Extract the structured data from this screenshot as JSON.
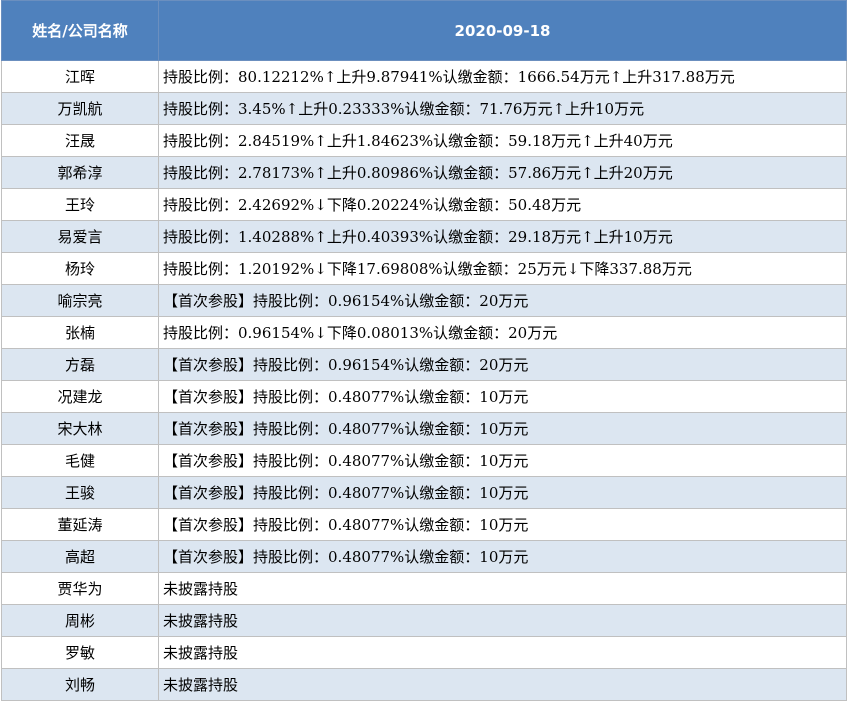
{
  "table": {
    "headers": [
      "姓名/公司名称",
      "2020-09-18"
    ],
    "rows": [
      {
        "name": "江晖",
        "info": "持股比例：80.12212%↑上升9.87941%认缴金额：1666.54万元↑上升317.88万元"
      },
      {
        "name": "万凯航",
        "info": "持股比例：3.45%↑上升0.23333%认缴金额：71.76万元↑上升10万元"
      },
      {
        "name": "汪晟",
        "info": "持股比例：2.84519%↑上升1.84623%认缴金额：59.18万元↑上升40万元"
      },
      {
        "name": "郭希淳",
        "info": "持股比例：2.78173%↑上升0.80986%认缴金额：57.86万元↑上升20万元"
      },
      {
        "name": "王玲",
        "info": "持股比例：2.42692%↓下降0.20224%认缴金额：50.48万元"
      },
      {
        "name": "易爱言",
        "info": "持股比例：1.40288%↑上升0.40393%认缴金额：29.18万元↑上升10万元"
      },
      {
        "name": "杨玲",
        "info": "持股比例：1.20192%↓下降17.69808%认缴金额：25万元↓下降337.88万元"
      },
      {
        "name": "喻宗亮",
        "info": "【首次参股】持股比例：0.96154%认缴金额：20万元"
      },
      {
        "name": "张楠",
        "info": "持股比例：0.96154%↓下降0.08013%认缴金额：20万元"
      },
      {
        "name": "方磊",
        "info": "【首次参股】持股比例：0.96154%认缴金额：20万元"
      },
      {
        "name": "况建龙",
        "info": "【首次参股】持股比例：0.48077%认缴金额：10万元"
      },
      {
        "name": "宋大林",
        "info": "【首次参股】持股比例：0.48077%认缴金额：10万元"
      },
      {
        "name": "毛健",
        "info": "【首次参股】持股比例：0.48077%认缴金额：10万元"
      },
      {
        "name": "王骏",
        "info": "【首次参股】持股比例：0.48077%认缴金额：10万元"
      },
      {
        "name": "董延涛",
        "info": "【首次参股】持股比例：0.48077%认缴金额：10万元"
      },
      {
        "name": "高超",
        "info": "【首次参股】持股比例：0.48077%认缴金额：10万元"
      },
      {
        "name": "贾华为",
        "info": "未披露持股"
      },
      {
        "name": "周彬",
        "info": "未披露持股"
      },
      {
        "name": "罗敏",
        "info": "未披露持股"
      },
      {
        "name": "刘畅",
        "info": "未披露持股"
      }
    ]
  },
  "colors": {
    "header_bg": "#4f81bd",
    "header_text": "#ffffff",
    "alt_row_bg": "#dce6f1",
    "row_bg": "#ffffff",
    "grid": "#c0c0c0"
  }
}
